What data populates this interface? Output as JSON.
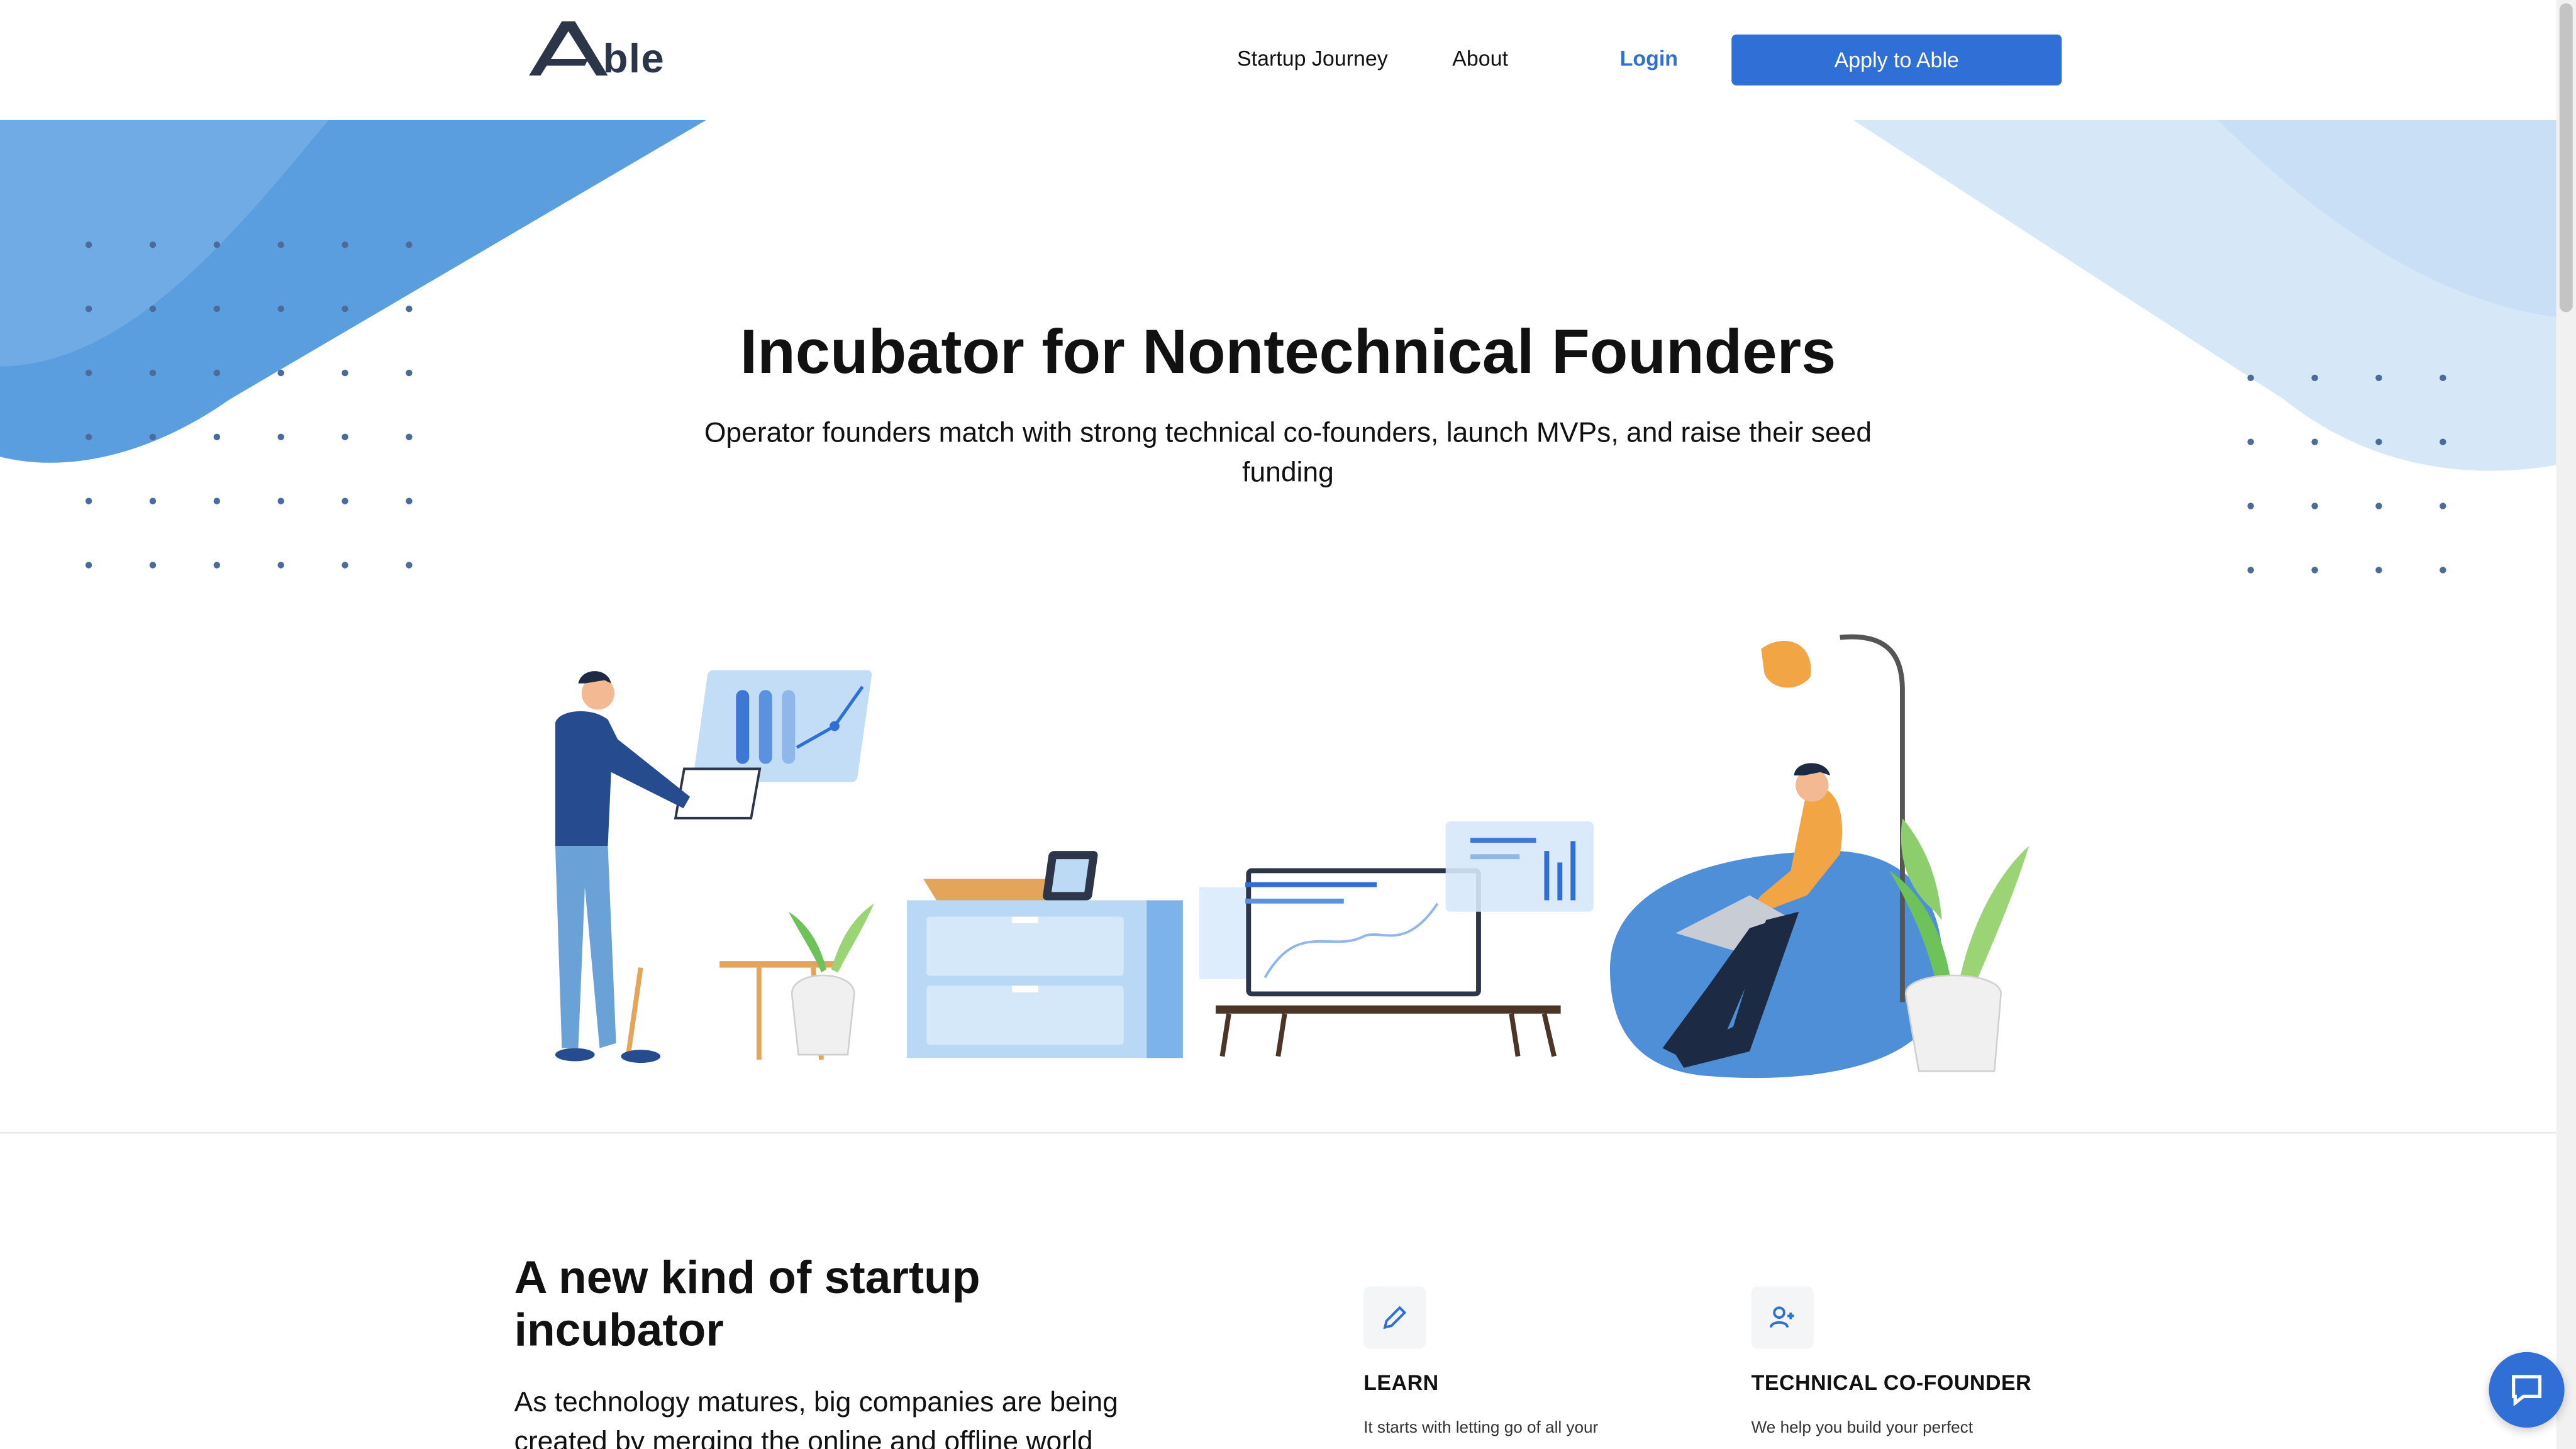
{
  "header": {
    "logo_text": "ble",
    "nav": {
      "startup_journey": "Startup Journey",
      "about": "About",
      "login": "Login"
    },
    "apply_button": "Apply to Able"
  },
  "hero": {
    "title": "Incubator for Nontechnical Founders",
    "subtitle": "Operator founders match with strong technical co-founders, launch MVPs, and raise their seed funding"
  },
  "section": {
    "title": "A new kind of startup incubator",
    "body": "As technology matures, big companies are being created by merging the online and offline world"
  },
  "features": [
    {
      "icon": "pencil-icon",
      "title": "LEARN",
      "text": "It starts with letting go of all your"
    },
    {
      "icon": "add-user-icon",
      "title": "TECHNICAL CO-FOUNDER",
      "text": "We help you build your perfect"
    }
  ],
  "colors": {
    "accent": "#2f6fd6",
    "deco_blue": "#5b9ee0",
    "deco_light": "#d6e8f8"
  }
}
